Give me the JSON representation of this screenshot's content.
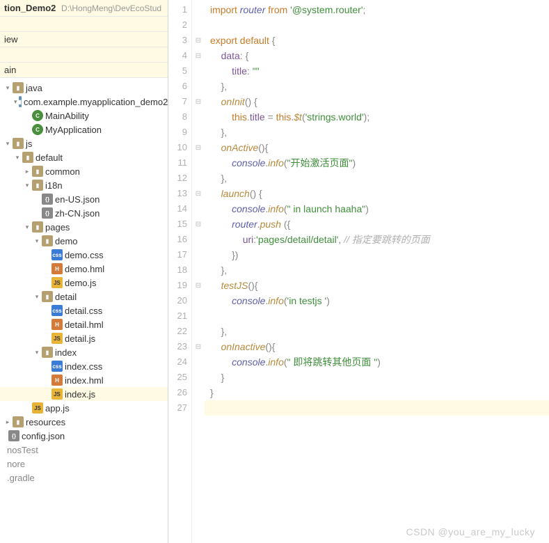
{
  "project": {
    "name": "tion_Demo2",
    "path": "D:\\HongMeng\\DevEcoStud"
  },
  "topRows": [
    "",
    "iew",
    "",
    "ain"
  ],
  "tree": [
    {
      "indent": 0,
      "arrow": "v",
      "icon": "folder",
      "label": "java"
    },
    {
      "indent": 1,
      "arrow": "v",
      "icon": "folder-blue",
      "label": "com.example.myapplication_demo2"
    },
    {
      "indent": 2,
      "arrow": "",
      "icon": "c",
      "label": "MainAbility"
    },
    {
      "indent": 2,
      "arrow": "",
      "icon": "c",
      "label": "MyApplication"
    },
    {
      "indent": 0,
      "arrow": "v",
      "icon": "folder",
      "label": "js"
    },
    {
      "indent": 1,
      "arrow": "v",
      "icon": "folder",
      "label": "default"
    },
    {
      "indent": 2,
      "arrow": ">",
      "icon": "folder",
      "label": "common"
    },
    {
      "indent": 2,
      "arrow": "v",
      "icon": "folder",
      "label": "i18n"
    },
    {
      "indent": 3,
      "arrow": "",
      "icon": "json",
      "label": "en-US.json"
    },
    {
      "indent": 3,
      "arrow": "",
      "icon": "json",
      "label": "zh-CN.json"
    },
    {
      "indent": 2,
      "arrow": "v",
      "icon": "folder",
      "label": "pages"
    },
    {
      "indent": 3,
      "arrow": "v",
      "icon": "folder",
      "label": "demo"
    },
    {
      "indent": 4,
      "arrow": "",
      "icon": "css",
      "label": "demo.css"
    },
    {
      "indent": 4,
      "arrow": "",
      "icon": "hml",
      "label": "demo.hml"
    },
    {
      "indent": 4,
      "arrow": "",
      "icon": "js",
      "label": "demo.js"
    },
    {
      "indent": 3,
      "arrow": "v",
      "icon": "folder",
      "label": "detail"
    },
    {
      "indent": 4,
      "arrow": "",
      "icon": "css",
      "label": "detail.css"
    },
    {
      "indent": 4,
      "arrow": "",
      "icon": "hml",
      "label": "detail.hml"
    },
    {
      "indent": 4,
      "arrow": "",
      "icon": "js",
      "label": "detail.js"
    },
    {
      "indent": 3,
      "arrow": "v",
      "icon": "folder",
      "label": "index"
    },
    {
      "indent": 4,
      "arrow": "",
      "icon": "css",
      "label": "index.css"
    },
    {
      "indent": 4,
      "arrow": "",
      "icon": "hml",
      "label": "index.hml"
    },
    {
      "indent": 4,
      "arrow": "",
      "icon": "js",
      "label": "index.js",
      "sel": true
    },
    {
      "indent": 2,
      "arrow": "",
      "icon": "js",
      "label": "app.js"
    },
    {
      "indent": 0,
      "arrow": ">",
      "icon": "folder",
      "label": "resources"
    },
    {
      "indent": 0,
      "arrow": "",
      "icon": "json",
      "label": "config.json",
      "cut": true
    },
    {
      "indent": 0,
      "arrow": "",
      "icon": "",
      "label": "nosTest",
      "cut": true,
      "gray": true
    },
    {
      "indent": 0,
      "arrow": "",
      "icon": "",
      "label": "nore",
      "cut": true,
      "gray": true
    },
    {
      "indent": 0,
      "arrow": "",
      "icon": "",
      "label": ".gradle",
      "cut": true,
      "gray": true
    }
  ],
  "code": [
    {
      "n": 1,
      "t": [
        [
          "kw",
          "import"
        ],
        [
          "",
          " "
        ],
        [
          "id",
          "router"
        ],
        [
          "",
          " "
        ],
        [
          "kw",
          "from"
        ],
        [
          "",
          " "
        ],
        [
          "str",
          "'@system.router'"
        ],
        [
          "pun",
          ";"
        ]
      ]
    },
    {
      "n": 2,
      "t": []
    },
    {
      "n": 3,
      "t": [
        [
          "kw",
          "export default"
        ],
        [
          "",
          " "
        ],
        [
          "pun",
          "{"
        ]
      ]
    },
    {
      "n": 4,
      "t": [
        [
          "",
          "    "
        ],
        [
          "prop",
          "data"
        ],
        [
          "pun",
          ": {"
        ]
      ]
    },
    {
      "n": 5,
      "t": [
        [
          "",
          "        "
        ],
        [
          "prop",
          "title"
        ],
        [
          "pun",
          ": "
        ],
        [
          "str",
          "\"\""
        ]
      ]
    },
    {
      "n": 6,
      "t": [
        [
          "",
          "    "
        ],
        [
          "pun",
          "},"
        ]
      ]
    },
    {
      "n": 7,
      "t": [
        [
          "",
          "    "
        ],
        [
          "fn",
          "onInit"
        ],
        [
          "pun",
          "() {"
        ]
      ]
    },
    {
      "n": 8,
      "t": [
        [
          "",
          "        "
        ],
        [
          "this",
          "this"
        ],
        [
          "pun",
          "."
        ],
        [
          "prop",
          "title"
        ],
        [
          "pun",
          " = "
        ],
        [
          "this",
          "this"
        ],
        [
          "pun",
          "."
        ],
        [
          "fn",
          "$t"
        ],
        [
          "pun",
          "("
        ],
        [
          "str",
          "'strings.world'"
        ],
        [
          "pun",
          ");"
        ]
      ]
    },
    {
      "n": 9,
      "t": [
        [
          "",
          "    "
        ],
        [
          "pun",
          "},"
        ]
      ]
    },
    {
      "n": 10,
      "t": [
        [
          "",
          "    "
        ],
        [
          "fn",
          "onActive"
        ],
        [
          "pun",
          "(){"
        ]
      ]
    },
    {
      "n": 11,
      "t": [
        [
          "",
          "        "
        ],
        [
          "id",
          "console"
        ],
        [
          "pun",
          "."
        ],
        [
          "fn",
          "info"
        ],
        [
          "pun",
          "("
        ],
        [
          "str",
          "\"开始激活页面\""
        ],
        [
          "pun",
          ")"
        ]
      ]
    },
    {
      "n": 12,
      "t": [
        [
          "",
          "    "
        ],
        [
          "pun",
          "},"
        ]
      ]
    },
    {
      "n": 13,
      "t": [
        [
          "",
          "    "
        ],
        [
          "fn",
          "launch"
        ],
        [
          "pun",
          "() {"
        ]
      ]
    },
    {
      "n": 14,
      "t": [
        [
          "",
          "        "
        ],
        [
          "id",
          "console"
        ],
        [
          "pun",
          "."
        ],
        [
          "fn",
          "info"
        ],
        [
          "pun",
          "("
        ],
        [
          "str",
          "\" in launch haaha\""
        ],
        [
          "pun",
          ")"
        ]
      ]
    },
    {
      "n": 15,
      "t": [
        [
          "",
          "        "
        ],
        [
          "id",
          "router"
        ],
        [
          "pun",
          "."
        ],
        [
          "fn",
          "push"
        ],
        [
          "",
          " "
        ],
        [
          "pun",
          "({"
        ]
      ]
    },
    {
      "n": 16,
      "t": [
        [
          "",
          "            "
        ],
        [
          "prop",
          "uri"
        ],
        [
          "pun",
          ":"
        ],
        [
          "str",
          "'pages/detail/detail'"
        ],
        [
          "pun",
          ", "
        ],
        [
          "cmt",
          "// 指定要跳转的页面"
        ]
      ]
    },
    {
      "n": 17,
      "t": [
        [
          "",
          "        "
        ],
        [
          "pun",
          "})"
        ]
      ]
    },
    {
      "n": 18,
      "t": [
        [
          "",
          "    "
        ],
        [
          "pun",
          "},"
        ]
      ]
    },
    {
      "n": 19,
      "t": [
        [
          "",
          "    "
        ],
        [
          "fn",
          "testJS"
        ],
        [
          "pun",
          "(){"
        ]
      ]
    },
    {
      "n": 20,
      "t": [
        [
          "",
          "        "
        ],
        [
          "id",
          "console"
        ],
        [
          "pun",
          "."
        ],
        [
          "fn",
          "info"
        ],
        [
          "pun",
          "("
        ],
        [
          "str",
          "'in testjs '"
        ],
        [
          "pun",
          ")"
        ]
      ]
    },
    {
      "n": 21,
      "t": []
    },
    {
      "n": 22,
      "t": [
        [
          "",
          "    "
        ],
        [
          "pun",
          "},"
        ]
      ]
    },
    {
      "n": 23,
      "t": [
        [
          "",
          "    "
        ],
        [
          "fn",
          "onInactive"
        ],
        [
          "pun",
          "(){"
        ]
      ]
    },
    {
      "n": 24,
      "t": [
        [
          "",
          "        "
        ],
        [
          "id",
          "console"
        ],
        [
          "pun",
          "."
        ],
        [
          "fn",
          "info"
        ],
        [
          "pun",
          "("
        ],
        [
          "str",
          "\" 即将跳转其他页面 \""
        ],
        [
          "pun",
          ")"
        ]
      ]
    },
    {
      "n": 25,
      "t": [
        [
          "",
          "    "
        ],
        [
          "pun",
          "}"
        ]
      ]
    },
    {
      "n": 26,
      "t": [
        [
          "pun",
          "}"
        ]
      ]
    },
    {
      "n": 27,
      "t": [],
      "cur": true
    }
  ],
  "foldable": [
    3,
    4,
    7,
    10,
    13,
    15,
    19,
    23
  ],
  "watermark": "CSDN @you_are_my_lucky"
}
